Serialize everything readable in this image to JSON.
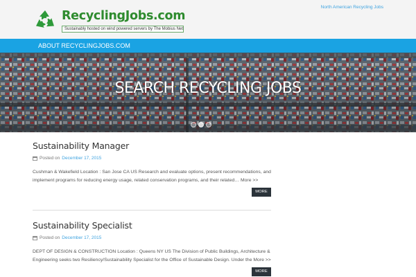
{
  "header": {
    "logo_text": "RecyclingJobs.com",
    "logo_tagline": "Sustainably hosted on wind powered servers by The Mobius Network.",
    "top_link": "North American Recycling Jobs"
  },
  "nav": {
    "items": [
      {
        "label": "ABOUT RECYCLINGJOBS.COM"
      }
    ]
  },
  "hero": {
    "title": "SEARCH RECYCLING JOBS",
    "slide_count": 3,
    "active_slide": 2
  },
  "posts": [
    {
      "title": "Sustainability Manager",
      "posted_prefix": "Posted on",
      "date": "December 17, 2015",
      "excerpt": "Cushman & Wakefield Location : San Jose CA US Research and evaluate options, present recommendations, and implement programs for reducing energy usage, related conservation programs, and their related… ",
      "more_link": "More >>",
      "more_button": "MORE"
    },
    {
      "title": "Sustainability Specialist",
      "posted_prefix": "Posted on",
      "date": "December 17, 2015",
      "excerpt": "DEPT OF DESIGN & CONSTRUCTION Location : Queens NY US The Division of Public Buildings, Architecture & Engineering seeks two Resiliency/Sustainability Specialist for the Office of Sustainable Design. Under the ",
      "more_link": "More >>",
      "more_button": "MORE"
    }
  ],
  "colors": {
    "nav_blue": "#1aa3e3",
    "link_blue": "#3ea3e0",
    "logo_green": "#2e8b2e",
    "button_dark": "#2b333a"
  }
}
